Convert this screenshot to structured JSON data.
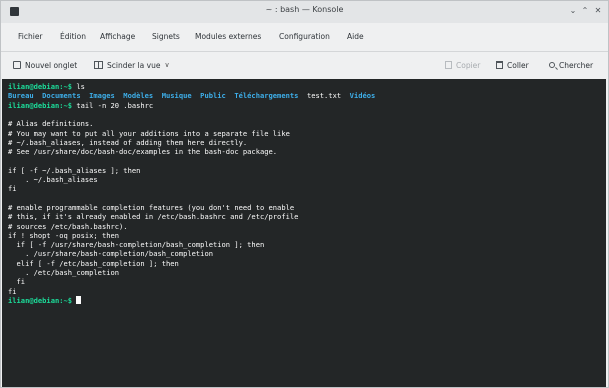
{
  "window": {
    "title": "~ : bash — Konsole",
    "minimize_glyph": "⌄",
    "maximize_glyph": "⌃",
    "close_glyph": "✕"
  },
  "menubar": {
    "items": [
      "Fichier",
      "Édition",
      "Affichage",
      "Signets",
      "Modules externes",
      "Configuration",
      "Aide"
    ]
  },
  "toolbar": {
    "new_tab": "Nouvel onglet",
    "split_view": "Scinder la vue",
    "copy": "Copier",
    "paste": "Coller",
    "search": "Chercher"
  },
  "terminal": {
    "prompt": "ilian@debian:~$",
    "cmd1": " ls",
    "ls_dirs": "Bureau  Documents  Images  Modèles  Musique  Public  Téléchargements",
    "ls_files": "  test.txt  ",
    "ls_last_dir": "Vidéos",
    "cmd2": " tail -n 20 .bashrc",
    "output": [
      "",
      "# Alias definitions.",
      "# You may want to put all your additions into a separate file like",
      "# ~/.bash_aliases, instead of adding them here directly.",
      "# See /usr/share/doc/bash-doc/examples in the bash-doc package.",
      "",
      "if [ -f ~/.bash_aliases ]; then",
      "    . ~/.bash_aliases",
      "fi",
      "",
      "# enable programmable completion features (you don't need to enable",
      "# this, if it's already enabled in /etc/bash.bashrc and /etc/profile",
      "# sources /etc/bash.bashrc).",
      "if ! shopt -oq posix; then",
      "  if [ -f /usr/share/bash-completion/bash_completion ]; then",
      "    . /usr/share/bash-completion/bash_completion",
      "  elif [ -f /etc/bash_completion ]; then",
      "    . /etc/bash_completion",
      "  fi",
      "fi"
    ],
    "colors": {
      "background": "#232627",
      "text": "#fcfcfc",
      "prompt": "#1cdc9a",
      "directory": "#3daee9"
    }
  }
}
